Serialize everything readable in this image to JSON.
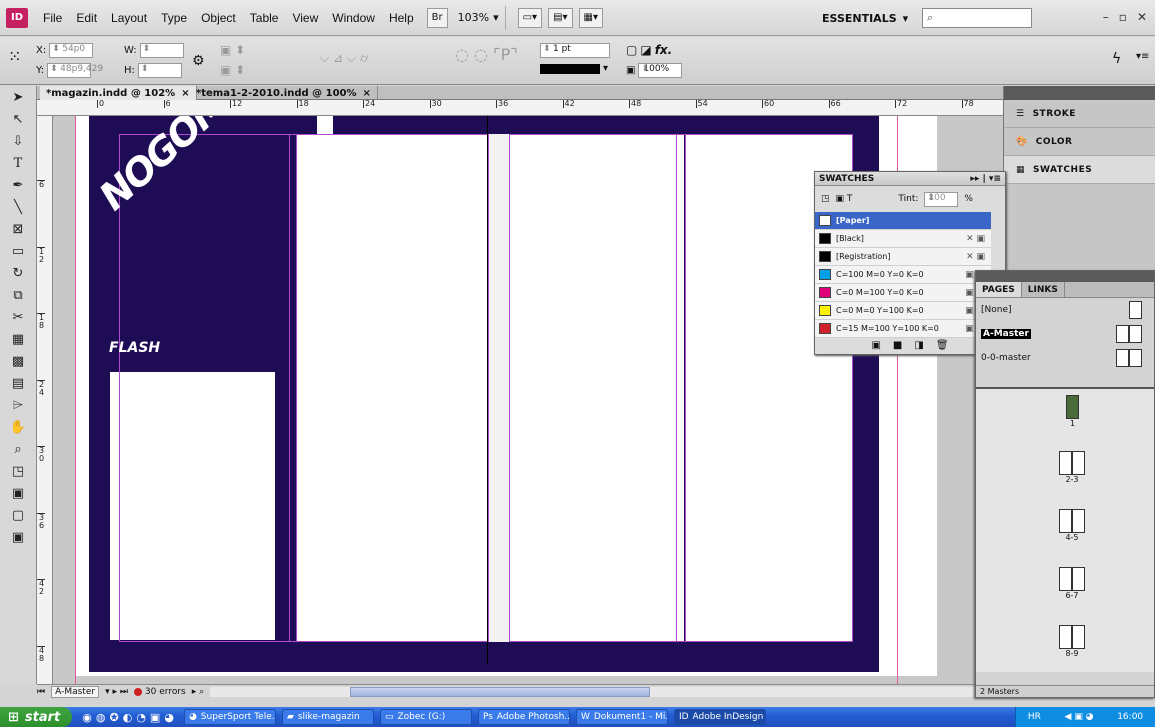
{
  "app": {
    "logo": "ID",
    "menus": [
      "File",
      "Edit",
      "Layout",
      "Type",
      "Object",
      "Table",
      "View",
      "Window",
      "Help"
    ],
    "bridge": "Br",
    "zoom": "103%",
    "workspace": "ESSENTIALS",
    "search_placeholder": ""
  },
  "control": {
    "x_label": "X:",
    "x_value": "54p0",
    "y_label": "Y:",
    "y_value": "48p9,429",
    "w_label": "W:",
    "h_label": "H:",
    "stroke_weight": "1 pt",
    "scale": "100%",
    "fx": "fx."
  },
  "tabs": [
    {
      "label": "*magazin.indd @ 102%",
      "close": "×"
    },
    {
      "label": "*tema1-2-2010.indd @ 100%",
      "close": "×"
    }
  ],
  "ruler": {
    "h_ticks": [
      "0",
      "6",
      "12",
      "18",
      "24",
      "30",
      "36",
      "42",
      "48",
      "54",
      "60",
      "66",
      "72",
      "78"
    ],
    "v_ticks": [
      "6",
      "1 2",
      "1 8",
      "2 4",
      "3 0",
      "3 6",
      "4 2",
      "4 8"
    ]
  },
  "doc": {
    "headline": "NOGOMET",
    "flash": "FLASH"
  },
  "status": {
    "page": "A-Master",
    "errors": "30 errors"
  },
  "dock": {
    "stroke": "STROKE",
    "color": "COLOR",
    "swatches": "SWATCHES"
  },
  "swatches": {
    "title": "SWATCHES",
    "tint_label": "Tint:",
    "tint_value": "100",
    "percent": "%",
    "rows": [
      {
        "name": "[Paper]",
        "color": "#ffffff"
      },
      {
        "name": "[Black]",
        "color": "#000000"
      },
      {
        "name": "[Registration]",
        "color": "#000000"
      },
      {
        "name": "C=100 M=0 Y=0 K=0",
        "color": "#00a0e6"
      },
      {
        "name": "C=0 M=100 Y=0 K=0",
        "color": "#e0007a"
      },
      {
        "name": "C=0 M=0 Y=100 K=0",
        "color": "#fff200"
      },
      {
        "name": "C=15 M=100 Y=100 K=0",
        "color": "#d0202a"
      }
    ]
  },
  "pages": {
    "tab_pages": "PAGES",
    "tab_links": "LINKS",
    "masters": [
      "[None]",
      "A-Master",
      "0-0-master"
    ],
    "spreads": [
      "1",
      "2-3",
      "4-5",
      "6-7",
      "8-9"
    ],
    "footer": "2 Masters"
  },
  "taskbar": {
    "start": "start",
    "items": [
      "SuperSport Tele...",
      "slike-magazin",
      "Zobec (G:)",
      "Adobe Photosh...",
      "Dokument1 - Mi...",
      "Adobe InDesign ..."
    ],
    "lang": "HR",
    "clock": "16:00"
  }
}
